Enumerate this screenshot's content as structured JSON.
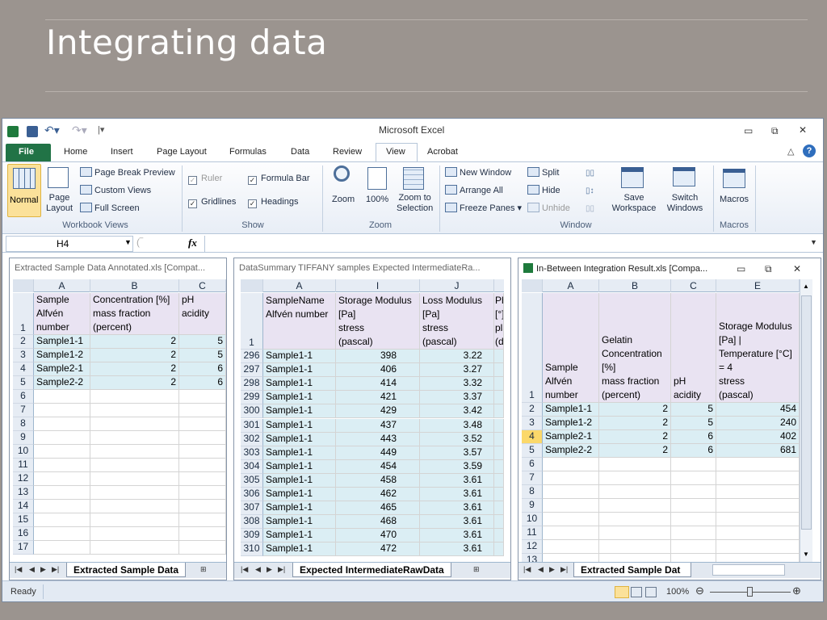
{
  "slide": {
    "title": "Integrating data"
  },
  "excel": {
    "title": "Microsoft Excel",
    "tabs": [
      "File",
      "Home",
      "Insert",
      "Page Layout",
      "Formulas",
      "Data",
      "Review",
      "View",
      "Acrobat"
    ],
    "active_tab": "View",
    "ribbon": {
      "workbook_views": {
        "label": "Workbook Views",
        "normal": "Normal",
        "page_layout": "Page\nLayout",
        "page_break_preview": "Page Break Preview",
        "custom_views": "Custom Views",
        "full_screen": "Full Screen"
      },
      "show": {
        "label": "Show",
        "ruler": "Ruler",
        "formula_bar": "Formula Bar",
        "gridlines": "Gridlines",
        "headings": "Headings"
      },
      "zoom": {
        "label": "Zoom",
        "zoom": "Zoom",
        "hundred": "100%",
        "zoom_to_selection": "Zoom to\nSelection"
      },
      "window": {
        "label": "Window",
        "new_window": "New Window",
        "arrange_all": "Arrange All",
        "freeze_panes": "Freeze Panes",
        "split": "Split",
        "hide": "Hide",
        "unhide": "Unhide",
        "save_workspace": "Save\nWorkspace",
        "switch_windows": "Switch\nWindows"
      },
      "macros": {
        "label": "Macros",
        "macros": "Macros"
      }
    },
    "formula_bar": {
      "name_box": "H4",
      "fx": "fx",
      "content": ""
    },
    "status": {
      "ready": "Ready",
      "zoom": "100%"
    },
    "colors": {
      "header_band": "#e9e3f2",
      "data_band": "#dbeef4",
      "accent": "#2f6ebd",
      "file_tab": "#217346"
    }
  },
  "ws1": {
    "title": "Extracted Sample Data Annotated.xls  [Compat...",
    "cols": [
      "A",
      "B",
      "C"
    ],
    "header": {
      "row": "1",
      "a": "Sample\nAlfvén\nnumber",
      "b": "Concentration [%]\nmass fraction\n(percent)",
      "c": "pH\nacidity"
    },
    "rows": [
      {
        "n": "2",
        "a": "Sample1-1",
        "b": "2",
        "c": "5"
      },
      {
        "n": "3",
        "a": "Sample1-2",
        "b": "2",
        "c": "5"
      },
      {
        "n": "4",
        "a": "Sample2-1",
        "b": "2",
        "c": "6"
      },
      {
        "n": "5",
        "a": "Sample2-2",
        "b": "2",
        "c": "6"
      }
    ],
    "empty_rows": [
      "6",
      "7",
      "8",
      "9",
      "10",
      "11",
      "12",
      "13",
      "14",
      "15",
      "16",
      "17"
    ],
    "sheet_tab": "Extracted Sample Data"
  },
  "ws2": {
    "title": "DataSummary TIFFANY samples Expected IntermediateRa...",
    "cols": [
      "A",
      "I",
      "J"
    ],
    "col_k_partial": "Ph\n[°]\npla\n(de",
    "header": {
      "row": "1",
      "a": "SampleName\nAlfvén number",
      "i": "Storage Modulus\n[Pa]\nstress\n(pascal)",
      "j": "Loss Modulus\n[Pa]\nstress\n(pascal)"
    },
    "rows": [
      {
        "n": "296",
        "a": "Sample1-1",
        "i": "398",
        "j": "3.22"
      },
      {
        "n": "297",
        "a": "Sample1-1",
        "i": "406",
        "j": "3.27"
      },
      {
        "n": "298",
        "a": "Sample1-1",
        "i": "414",
        "j": "3.32"
      },
      {
        "n": "299",
        "a": "Sample1-1",
        "i": "421",
        "j": "3.37"
      },
      {
        "n": "300",
        "a": "Sample1-1",
        "i": "429",
        "j": "3.42"
      },
      {
        "n": "301",
        "a": "Sample1-1",
        "i": "437",
        "j": "3.48"
      },
      {
        "n": "302",
        "a": "Sample1-1",
        "i": "443",
        "j": "3.52"
      },
      {
        "n": "303",
        "a": "Sample1-1",
        "i": "449",
        "j": "3.57"
      },
      {
        "n": "304",
        "a": "Sample1-1",
        "i": "454",
        "j": "3.59"
      },
      {
        "n": "305",
        "a": "Sample1-1",
        "i": "458",
        "j": "3.61"
      },
      {
        "n": "306",
        "a": "Sample1-1",
        "i": "462",
        "j": "3.61"
      },
      {
        "n": "307",
        "a": "Sample1-1",
        "i": "465",
        "j": "3.61"
      },
      {
        "n": "308",
        "a": "Sample1-1",
        "i": "468",
        "j": "3.61"
      },
      {
        "n": "309",
        "a": "Sample1-1",
        "i": "470",
        "j": "3.61"
      },
      {
        "n": "310",
        "a": "Sample1-1",
        "i": "472",
        "j": "3.61"
      }
    ],
    "sheet_tab": "Expected IntermediateRawData"
  },
  "ws3": {
    "title": "In-Between Integration Result.xls  [Compa...",
    "cols": [
      "A",
      "B",
      "C",
      "E"
    ],
    "header": {
      "row": "1",
      "a": "Sample\nAlfvén\nnumber",
      "b": "Gelatin\nConcentration\n[%]\nmass fraction\n(percent)",
      "c": "pH\nacidity",
      "e": "Storage Modulus\n[Pa] |\nTemperature [°C]\n= 4\nstress\n(pascal)"
    },
    "rows": [
      {
        "n": "2",
        "a": "Sample1-1",
        "b": "2",
        "c": "5",
        "e": "454"
      },
      {
        "n": "3",
        "a": "Sample1-2",
        "b": "2",
        "c": "5",
        "e": "240"
      },
      {
        "n": "4",
        "a": "Sample2-1",
        "b": "2",
        "c": "6",
        "e": "402"
      },
      {
        "n": "5",
        "a": "Sample2-2",
        "b": "2",
        "c": "6",
        "e": "681"
      }
    ],
    "empty_rows": [
      "6",
      "7",
      "8",
      "9",
      "10",
      "11",
      "12",
      "13"
    ],
    "sheet_tab": "Extracted Sample Dat"
  }
}
